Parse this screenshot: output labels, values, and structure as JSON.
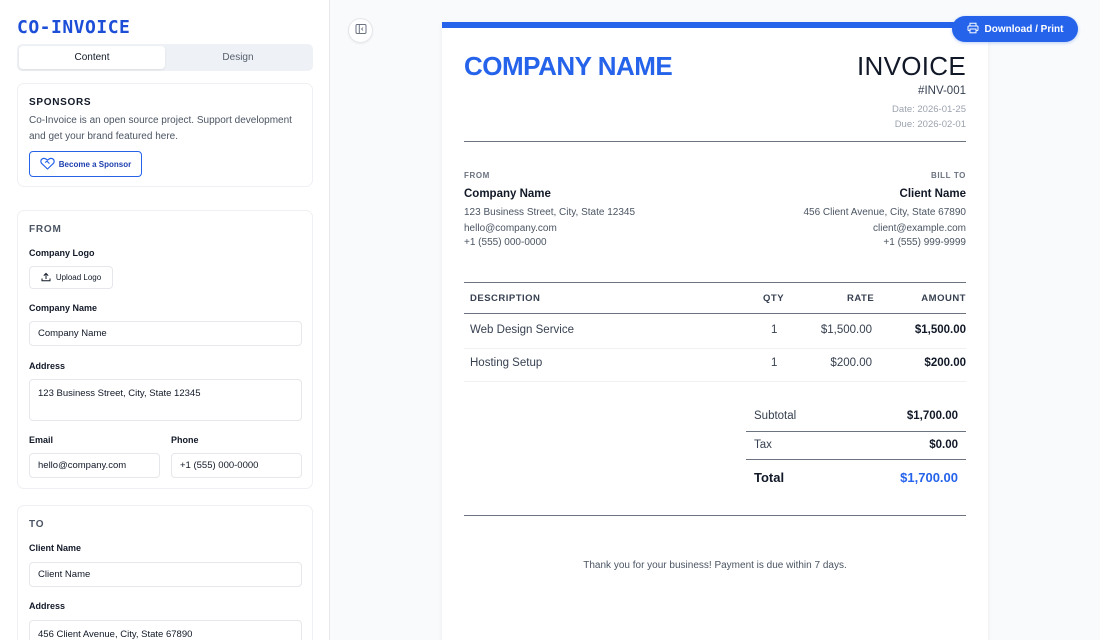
{
  "app": {
    "brand": "CO-INVOICE"
  },
  "tabs": [
    {
      "label": "Content",
      "active": true
    },
    {
      "label": "Design",
      "active": false
    }
  ],
  "sponsors": {
    "title": "SPONSORS",
    "text": "Co-Invoice is an open source project. Support development and get your brand featured here.",
    "button_label": "Become a Sponsor",
    "button_icon": "heart-handshake-icon"
  },
  "from_form": {
    "section_title": "FROM",
    "logo_label": "Company Logo",
    "upload_label": "Upload Logo",
    "upload_icon": "upload-icon",
    "company_label": "Company Name",
    "company_value": "Company Name",
    "address_label": "Address",
    "address_value": "123 Business Street, City, State 12345",
    "email_label": "Email",
    "email_value": "hello@company.com",
    "phone_label": "Phone",
    "phone_value": "+1 (555) 000-0000"
  },
  "to_form": {
    "section_title": "TO",
    "client_label": "Client Name",
    "client_value": "Client Name",
    "address_label": "Address",
    "address_value": "456 Client Avenue, City, State 67890"
  },
  "toolbar": {
    "toggle_icon": "sidebar-toggle-icon",
    "download_label": "Download / Print",
    "download_icon": "printer-icon"
  },
  "invoice": {
    "company_title": "COMPANY NAME",
    "title": "INVOICE",
    "number": "#INV-001",
    "date": "Date: 2026-01-25",
    "due": "Due: 2026-02-01",
    "from": {
      "label": "FROM",
      "name": "Company Name",
      "address": "123 Business Street, City, State 12345",
      "email": "hello@company.com",
      "phone": "+1 (555) 000-0000"
    },
    "bill_to": {
      "label": "BILL TO",
      "name": "Client Name",
      "address": "456 Client Avenue, City, State 67890",
      "email": "client@example.com",
      "phone": "+1 (555) 999-9999"
    },
    "columns": [
      "DESCRIPTION",
      "QTY",
      "RATE",
      "AMOUNT"
    ],
    "items": [
      {
        "description": "Web Design Service",
        "qty": "1",
        "rate": "$1,500.00",
        "amount": "$1,500.00"
      },
      {
        "description": "Hosting Setup",
        "qty": "1",
        "rate": "$200.00",
        "amount": "$200.00"
      }
    ],
    "subtotal_label": "Subtotal",
    "subtotal": "$1,700.00",
    "tax_label": "Tax",
    "tax": "$0.00",
    "total_label": "Total",
    "total": "$1,700.00",
    "footer": "Thank you for your business! Payment is due within 7 days."
  },
  "colors": {
    "accent": "#2563eb",
    "brand": "#1d4ed8"
  }
}
